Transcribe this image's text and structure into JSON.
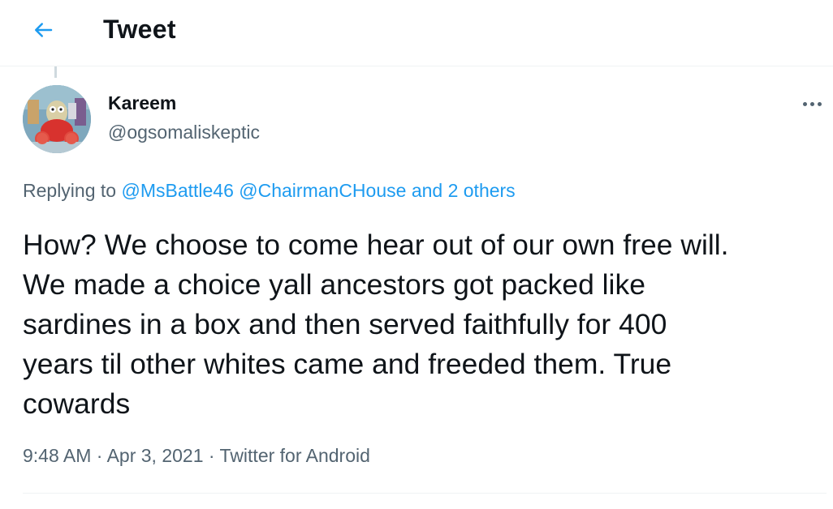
{
  "header": {
    "title": "Tweet",
    "back_icon": "arrow-left-icon",
    "accent_color": "#1d9bf0"
  },
  "tweet": {
    "author": {
      "display_name": "Kareem",
      "handle": "@ogsomaliskeptic",
      "avatar_icon": "avatar-image"
    },
    "more_icon": "more-options-icon",
    "replying_to": {
      "prefix": "Replying to",
      "users": [
        "@MsBattle46",
        "@ChairmanCHouse"
      ],
      "others": "and 2 others"
    },
    "text": "How? We choose to come hear out of our own free will.\nWe made a choice yall ancestors got packed like\nsardines in a box and then served faithfully for 400\nyears til other whites came and freeded them. True\ncowards",
    "time": "9:48 AM",
    "date": "Apr 3, 2021",
    "source": "Twitter for Android",
    "separator": "·"
  },
  "colors": {
    "text_primary": "#0f1419",
    "text_secondary": "#536471",
    "link": "#1d9bf0",
    "divider": "#eff3f4"
  }
}
